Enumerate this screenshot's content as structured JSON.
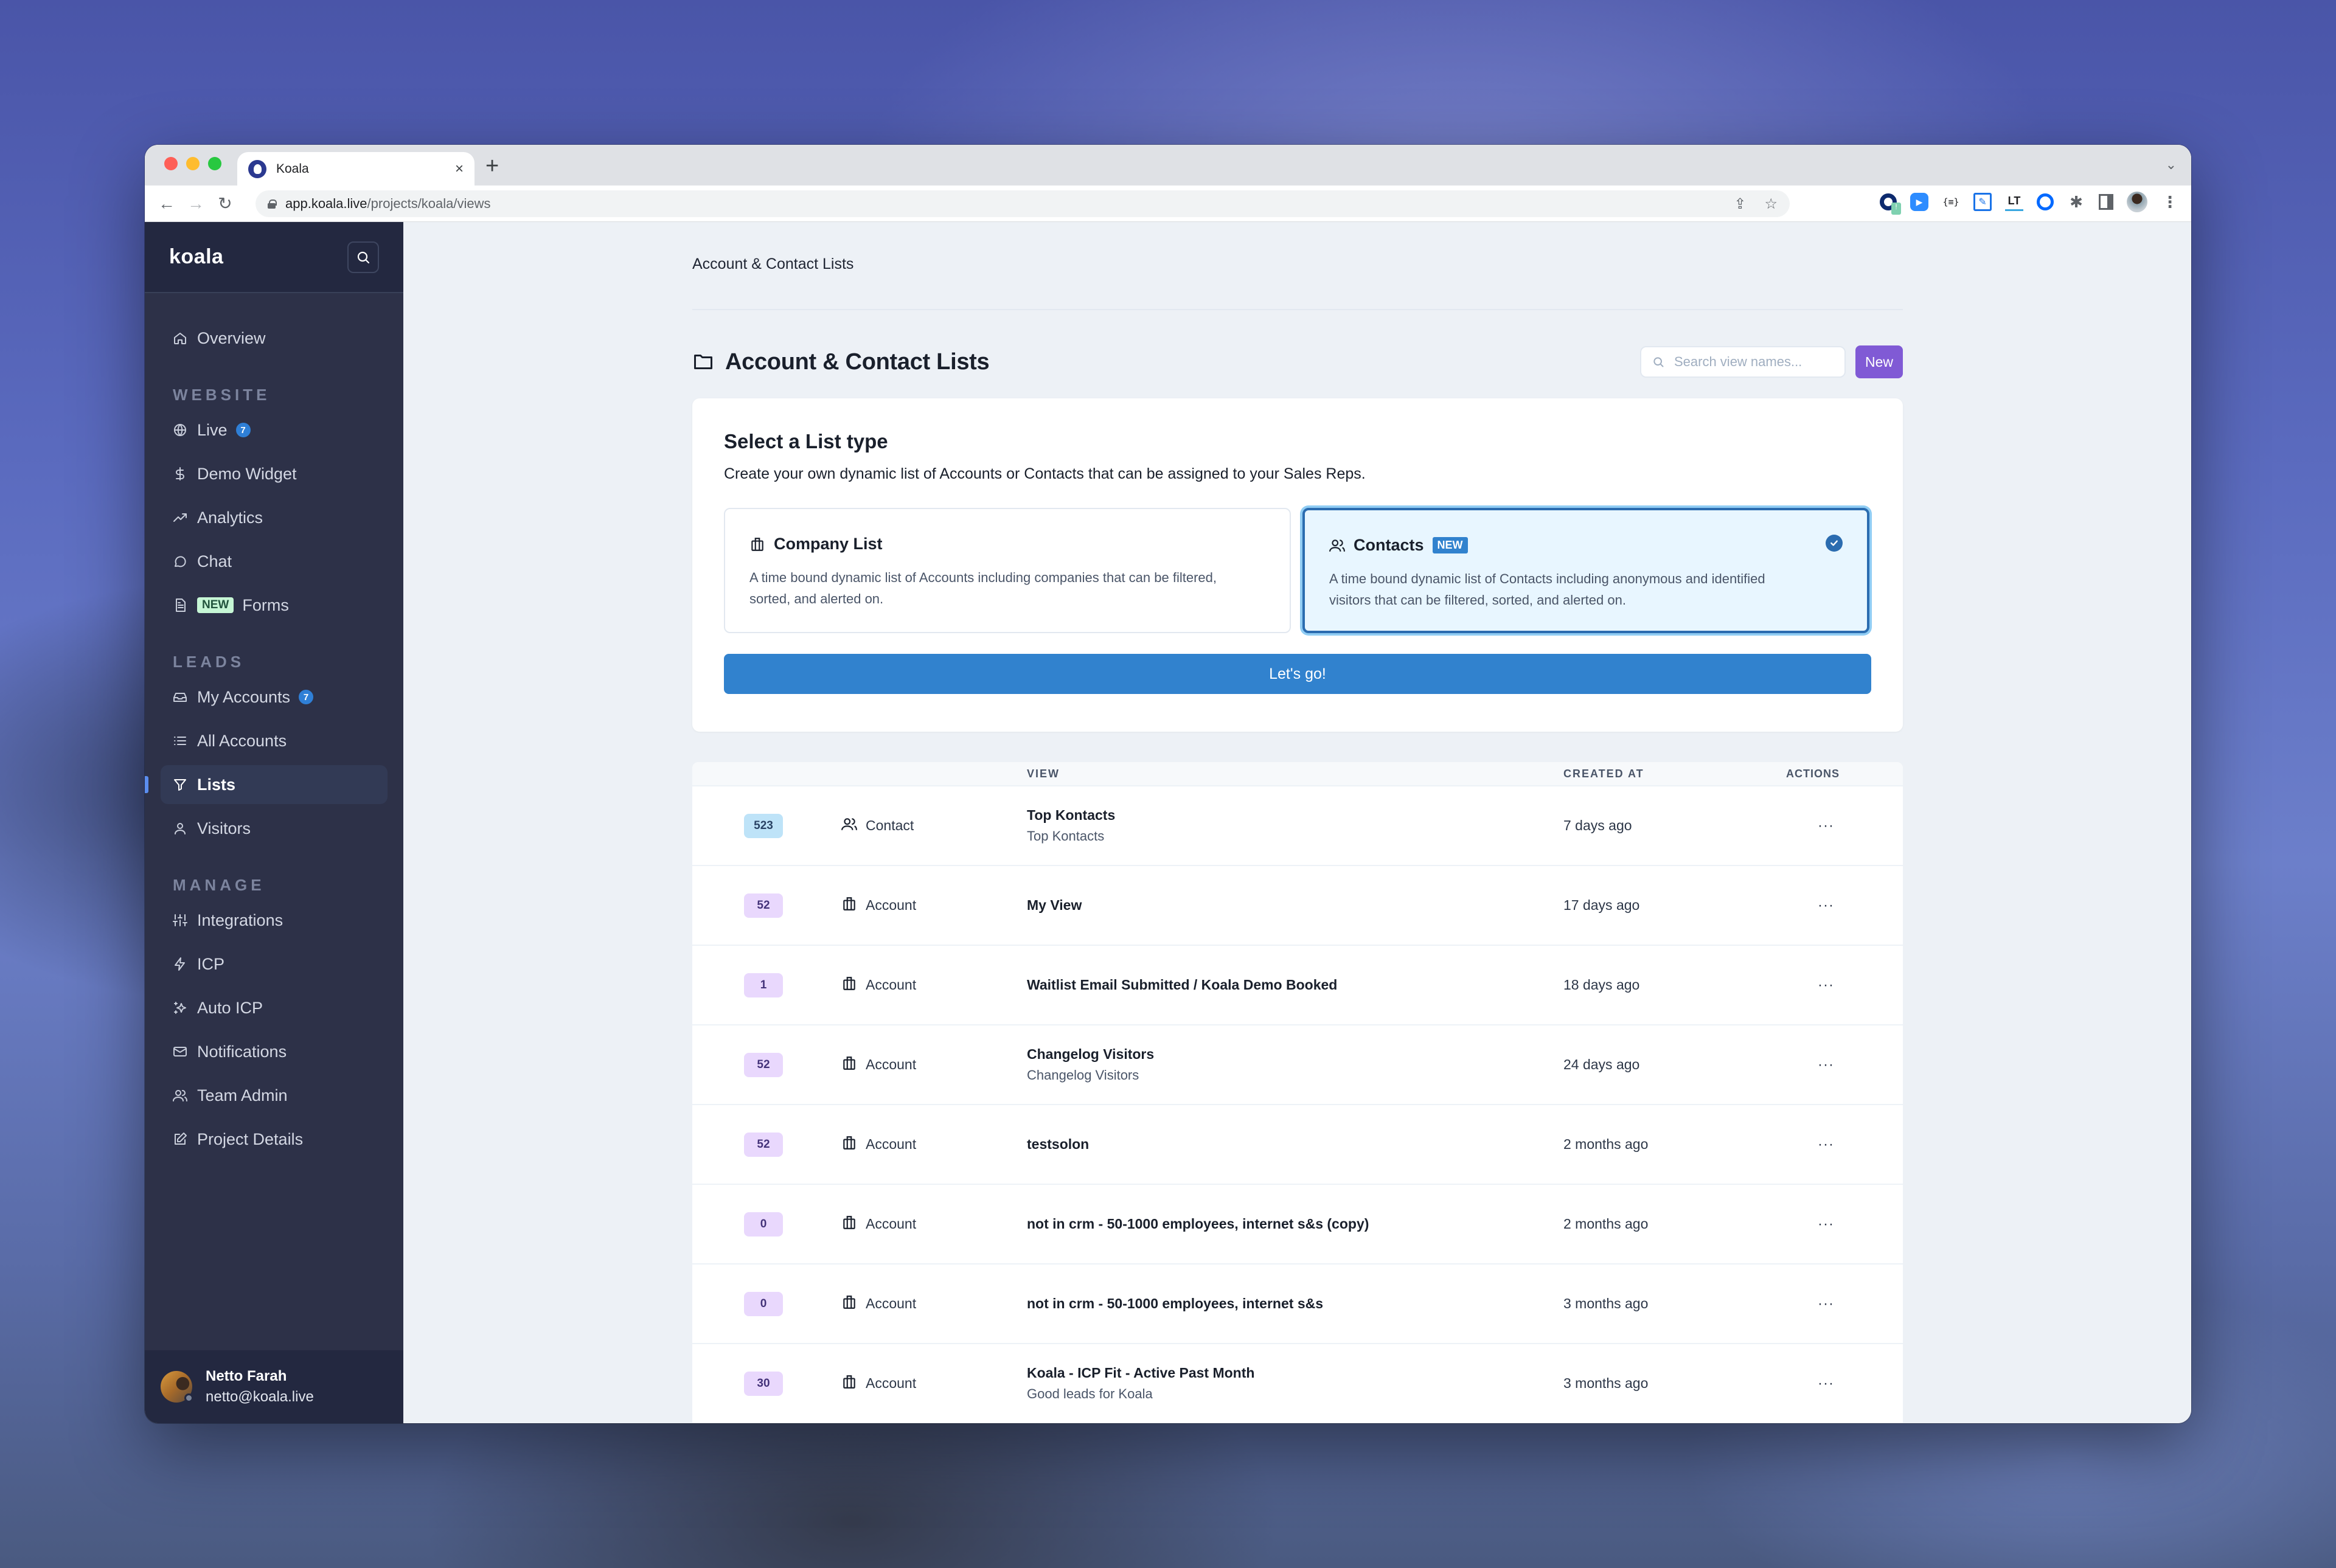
{
  "browser": {
    "tab_title": "Koala",
    "tab_close": "×",
    "new_tab": "+",
    "tab_dropdown": "⌄",
    "url_host": "app.koala.live",
    "url_path": "/projects/koala/views",
    "extensions": [
      "koala-extension",
      "zoom-extension",
      "json-formatter-extension",
      "notes-extension",
      "languagetool-extension",
      "calendly-extension",
      "extensions-puzzle",
      "side-panel",
      "profile-avatar",
      "menu"
    ]
  },
  "sidebar": {
    "brand": "koala",
    "items_top": [
      {
        "label": "Overview",
        "icon": "home-icon"
      }
    ],
    "sections": [
      {
        "title": "WEBSITE",
        "items": [
          {
            "label": "Live",
            "icon": "globe-icon",
            "count": "7"
          },
          {
            "label": "Demo Widget",
            "icon": "dollar-icon"
          },
          {
            "label": "Analytics",
            "icon": "trending-up-icon"
          },
          {
            "label": "Chat",
            "icon": "chat-icon"
          },
          {
            "label": "Forms",
            "icon": "document-icon",
            "badge": "NEW"
          }
        ]
      },
      {
        "title": "LEADS",
        "items": [
          {
            "label": "My Accounts",
            "icon": "inbox-icon",
            "count": "7"
          },
          {
            "label": "All Accounts",
            "icon": "list-icon"
          },
          {
            "label": "Lists",
            "icon": "filter-icon",
            "active": true
          },
          {
            "label": "Visitors",
            "icon": "user-icon"
          }
        ]
      },
      {
        "title": "MANAGE",
        "items": [
          {
            "label": "Integrations",
            "icon": "sliders-icon"
          },
          {
            "label": "ICP",
            "icon": "zap-icon"
          },
          {
            "label": "Auto ICP",
            "icon": "sparkles-icon"
          },
          {
            "label": "Notifications",
            "icon": "mail-icon"
          },
          {
            "label": "Team Admin",
            "icon": "users-icon"
          },
          {
            "label": "Project Details",
            "icon": "edit-icon"
          }
        ]
      }
    ],
    "user": {
      "name": "Netto Farah",
      "email": "netto@koala.live"
    }
  },
  "main": {
    "breadcrumb": "Account & Contact Lists",
    "title": "Account & Contact Lists",
    "search_placeholder": "Search view names...",
    "new_button": "New",
    "list_type": {
      "title": "Select a List type",
      "description": "Create your own dynamic list of Accounts or Contacts that can be assigned to your Sales Reps.",
      "options": [
        {
          "title": "Company List",
          "description": "A time bound dynamic list of Accounts including companies that can be filtered, sorted, and alerted on.",
          "selected": false
        },
        {
          "title": "Contacts",
          "badge": "NEW",
          "description": "A time bound dynamic list of Contacts including anonymous and identified visitors that can be filtered, sorted, and alerted on.",
          "selected": true
        }
      ],
      "submit": "Let's go!"
    },
    "table": {
      "columns": [
        "",
        "",
        "VIEW",
        "CREATED AT",
        "ACTIONS"
      ],
      "actions_glyph": "···",
      "rows": [
        {
          "count": "523",
          "kind": "contact",
          "type": "Contact",
          "name": "Top Kontacts",
          "subtitle": "Top Kontacts",
          "created": "7 days ago"
        },
        {
          "count": "52",
          "kind": "account",
          "type": "Account",
          "name": "My View",
          "subtitle": "",
          "created": "17 days ago"
        },
        {
          "count": "1",
          "kind": "account",
          "type": "Account",
          "name": "Waitlist Email Submitted / Koala Demo Booked",
          "subtitle": "",
          "created": "18 days ago"
        },
        {
          "count": "52",
          "kind": "account",
          "type": "Account",
          "name": "Changelog Visitors",
          "subtitle": "Changelog Visitors",
          "created": "24 days ago"
        },
        {
          "count": "52",
          "kind": "account",
          "type": "Account",
          "name": "testsolon",
          "subtitle": "",
          "created": "2 months ago"
        },
        {
          "count": "0",
          "kind": "account",
          "type": "Account",
          "name": "not in crm - 50-1000 employees, internet s&s (copy)",
          "subtitle": "",
          "created": "2 months ago"
        },
        {
          "count": "0",
          "kind": "account",
          "type": "Account",
          "name": "not in crm - 50-1000 employees, internet s&s",
          "subtitle": "",
          "created": "3 months ago"
        },
        {
          "count": "30",
          "kind": "account",
          "type": "Account",
          "name": "Koala - ICP Fit - Active Past Month",
          "subtitle": "Good leads for Koala",
          "created": "3 months ago"
        }
      ]
    }
  },
  "colors": {
    "sidebar_bg": "#2d3148",
    "accent_blue": "#3182ce",
    "new_button": "#805ad5",
    "selected_border": "#2b6cb0"
  }
}
